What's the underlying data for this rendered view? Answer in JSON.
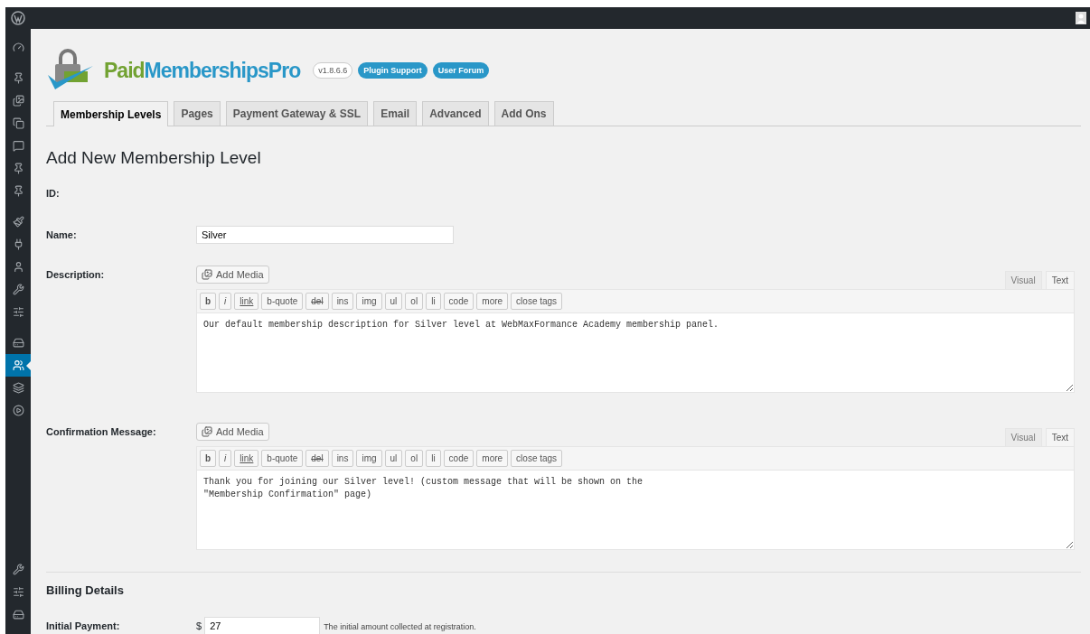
{
  "sidebar": {
    "groups": [
      [
        {
          "kind": "dashboard",
          "selected": false
        }
      ],
      [
        {
          "kind": "pin",
          "selected": false
        },
        {
          "kind": "media",
          "selected": false
        },
        {
          "kind": "pages",
          "selected": false
        },
        {
          "kind": "comments",
          "selected": false
        },
        {
          "kind": "pin",
          "selected": false
        },
        {
          "kind": "pin",
          "selected": false
        }
      ],
      [
        {
          "kind": "brush",
          "selected": false
        },
        {
          "kind": "plugin",
          "selected": false
        },
        {
          "kind": "user",
          "selected": false
        },
        {
          "kind": "wrench",
          "selected": false
        },
        {
          "kind": "settings",
          "selected": false
        }
      ],
      [
        {
          "kind": "disk",
          "selected": false
        },
        {
          "kind": "members",
          "selected": true
        },
        {
          "kind": "layers",
          "selected": false
        },
        {
          "kind": "play",
          "selected": false
        }
      ]
    ],
    "bottom": [
      {
        "kind": "wrench",
        "selected": false
      },
      {
        "kind": "settings",
        "selected": false
      },
      {
        "kind": "disk",
        "selected": false
      }
    ]
  },
  "header": {
    "logo_text": [
      {
        "text": "Paid",
        "color": "#72a232"
      },
      {
        "text": "MembershipsPro",
        "color": "#2997c8"
      }
    ],
    "version": "v1.8.6.6",
    "links": [
      "Plugin Support",
      "User Forum"
    ]
  },
  "tabs": [
    {
      "label": "Membership Levels",
      "selected": true
    },
    {
      "label": "Pages",
      "selected": false
    },
    {
      "label": "Payment Gateway & SSL",
      "selected": false
    },
    {
      "label": "Email",
      "selected": false
    },
    {
      "label": "Advanced",
      "selected": false
    },
    {
      "label": "Add Ons",
      "selected": false
    }
  ],
  "page_title": "Add New Membership Level",
  "id_label": "ID:",
  "name": {
    "label": "Name:",
    "value": "Silver"
  },
  "editors": [
    {
      "label": "Description:",
      "add_media": "Add Media",
      "modes": [
        {
          "label": "Visual",
          "selected": false
        },
        {
          "label": "Text",
          "selected": true
        }
      ],
      "quicktags": [
        {
          "label": "b",
          "kind": "bold"
        },
        {
          "label": "i",
          "kind": "italic"
        },
        {
          "label": "link",
          "kind": "link"
        },
        {
          "label": "b-quote",
          "kind": "plain"
        },
        {
          "label": "del",
          "kind": "strike"
        },
        {
          "label": "ins",
          "kind": "plain"
        },
        {
          "label": "img",
          "kind": "plain"
        },
        {
          "label": "ul",
          "kind": "plain"
        },
        {
          "label": "ol",
          "kind": "plain"
        },
        {
          "label": "li",
          "kind": "plain"
        },
        {
          "label": "code",
          "kind": "plain"
        },
        {
          "label": "more",
          "kind": "plain"
        },
        {
          "label": "close tags",
          "kind": "plain"
        }
      ],
      "value": "Our default membership description for Silver level at WebMaxFormance Academy membership panel."
    },
    {
      "label": "Confirmation Message:",
      "add_media": "Add Media",
      "modes": [
        {
          "label": "Visual",
          "selected": false
        },
        {
          "label": "Text",
          "selected": true
        }
      ],
      "quicktags": [
        {
          "label": "b",
          "kind": "bold"
        },
        {
          "label": "i",
          "kind": "italic"
        },
        {
          "label": "link",
          "kind": "link"
        },
        {
          "label": "b-quote",
          "kind": "plain"
        },
        {
          "label": "del",
          "kind": "strike"
        },
        {
          "label": "ins",
          "kind": "plain"
        },
        {
          "label": "img",
          "kind": "plain"
        },
        {
          "label": "ul",
          "kind": "plain"
        },
        {
          "label": "ol",
          "kind": "plain"
        },
        {
          "label": "li",
          "kind": "plain"
        },
        {
          "label": "code",
          "kind": "plain"
        },
        {
          "label": "more",
          "kind": "plain"
        },
        {
          "label": "close tags",
          "kind": "plain"
        }
      ],
      "value": "Thank you for joining our Silver level! (custom message that will be shown on the\n\"Membership Confirmation\" page)"
    }
  ],
  "billing": {
    "title": "Billing Details",
    "initial_payment": {
      "label": "Initial Payment:",
      "currency": "$",
      "value": "27",
      "hint": "The initial amount collected at registration."
    }
  }
}
